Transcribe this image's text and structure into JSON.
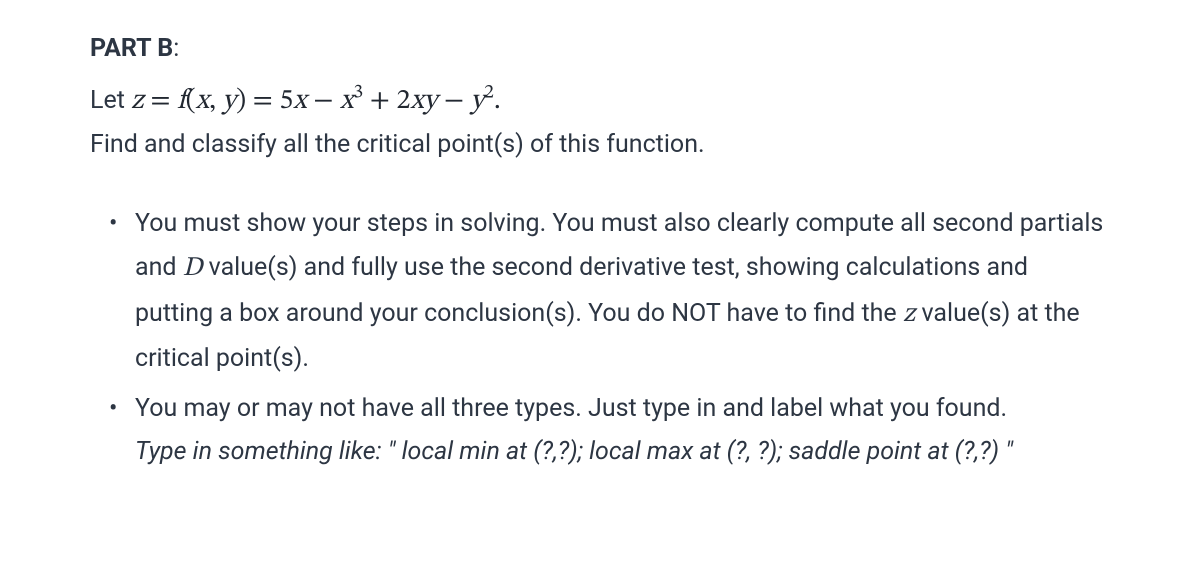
{
  "header": {
    "part_label": "PART B",
    "colon": ":"
  },
  "equation": {
    "let_text": "Let ",
    "z": "z",
    "eq1": " = ",
    "f": "f",
    "paren_open": "(",
    "x": "x",
    "comma": ", ",
    "y": "y",
    "paren_close": ")",
    "eq2": " = ",
    "term1_coef": "5",
    "term1_var": "x",
    "minus1": " − ",
    "term2_var": "x",
    "term2_exp": "3",
    "plus1": " + ",
    "term3_coef": "2",
    "term3_v1": "x",
    "term3_v2": "y",
    "minus2": " − ",
    "term4_var": "y",
    "term4_exp": "2",
    "period": "."
  },
  "instruction": "Find and classify all the critical point(s) of this function.",
  "bullets": {
    "b1_part1": "You must show your steps in solving. You must also clearly compute all second partials and ",
    "b1_D": "D",
    "b1_part2": " value(s) and fully use the second derivative test, showing calculations and putting a box around your conclusion(s). You do NOT have to find the ",
    "b1_z": "z",
    "b1_part3": " value(s) at the critical point(s).",
    "b2_text": "You may or may not have all three types. Just type in and label what you found.",
    "b2_example": "Type in something like:  \"  local min at (?,?);  local max at (?, ?);  saddle point at (?,?)  \""
  }
}
